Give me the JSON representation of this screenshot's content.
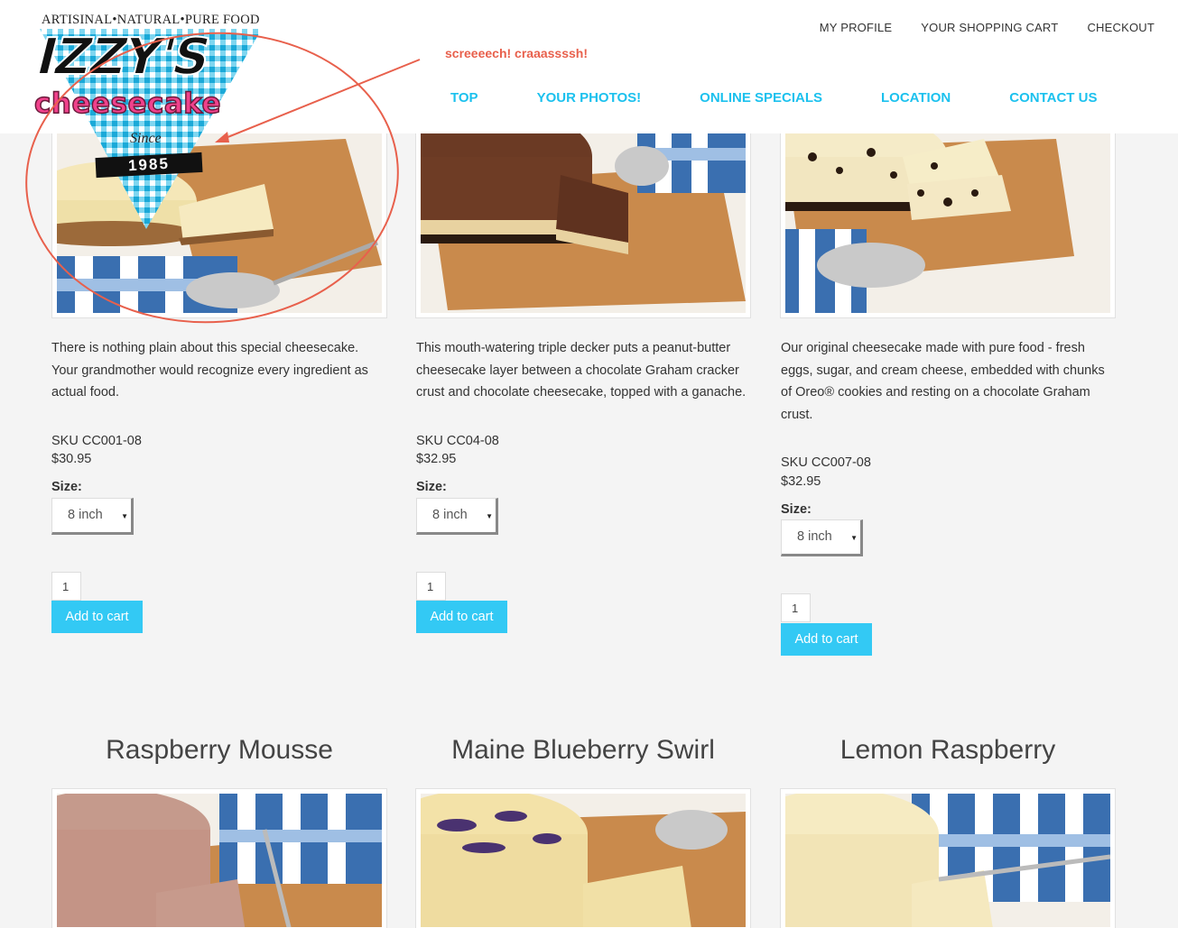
{
  "header": {
    "utility_links": [
      "MY PROFILE",
      "YOUR SHOPPING CART",
      "CHECKOUT"
    ],
    "main_nav": [
      "TOP",
      "YOUR PHOTOS!",
      "ONLINE SPECIALS",
      "LOCATION",
      "CONTACT US"
    ]
  },
  "logo": {
    "tagline": "ARTISINAL•NATURAL•PURE FOOD",
    "name": "IZZY'S",
    "sub": "cheesecake",
    "since": "Since",
    "year": "1985"
  },
  "annotation": {
    "text": "screeeech! craaassssh!",
    "color": "#e8604c"
  },
  "colors": {
    "accent": "#1cc1ee",
    "button": "#33c9f4"
  },
  "products": [
    {
      "description": "There is nothing plain about this special cheesecake. Your grandmother would recognize every ingredient as actual food.",
      "sku": "SKU CC001-08",
      "price": "$30.95",
      "size_label": "Size:",
      "size": "8 inch",
      "qty": "1",
      "button": "Add to cart"
    },
    {
      "description": "This mouth-watering triple decker puts a peanut-butter cheesecake layer between a chocolate Graham cracker crust and chocolate cheesecake, topped with a ganache.",
      "sku": "SKU CC04-08",
      "price": "$32.95",
      "size_label": "Size:",
      "size": "8 inch",
      "qty": "1",
      "button": "Add to cart"
    },
    {
      "description": "Our original cheesecake made with pure food - fresh eggs, sugar, and cream cheese, embedded with chunks of Oreo® cookies and resting on a chocolate Graham crust.",
      "sku": "SKU CC007-08",
      "price": "$32.95",
      "size_label": "Size:",
      "size": "8 inch",
      "qty": "1",
      "button": "Add to cart"
    }
  ],
  "next_products": [
    {
      "title": "Raspberry Mousse"
    },
    {
      "title": "Maine Blueberry Swirl"
    },
    {
      "title": "Lemon Raspberry"
    }
  ]
}
